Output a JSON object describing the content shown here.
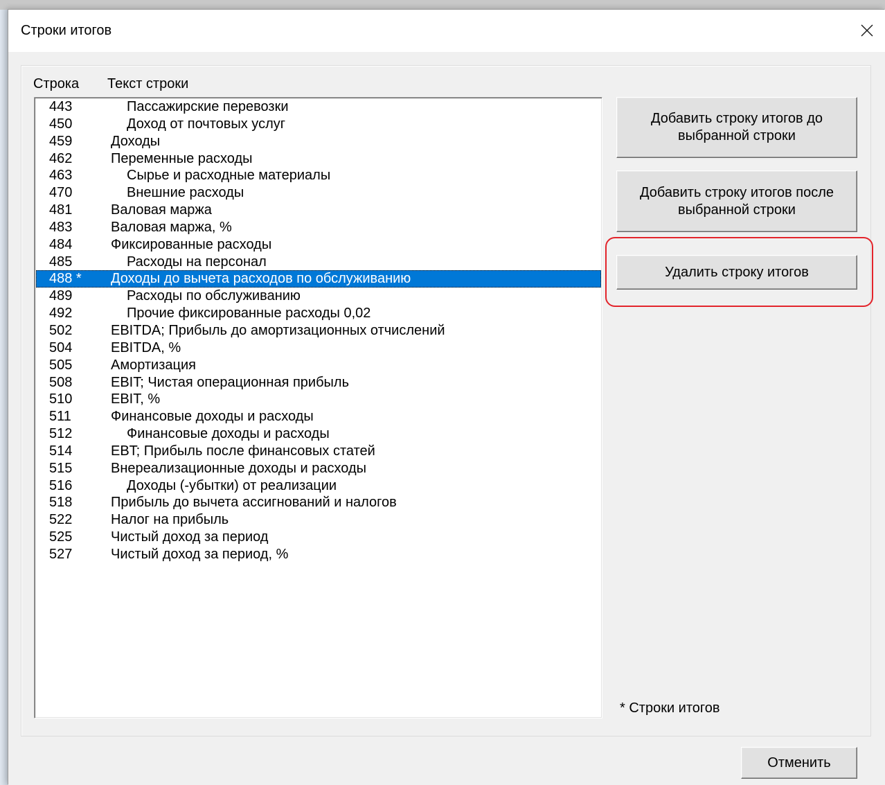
{
  "window": {
    "title": "Строки итогов",
    "close_icon": "close-icon"
  },
  "list": {
    "headers": {
      "number": "Строка",
      "text": "Текст строки"
    },
    "rows": [
      {
        "number": "443",
        "text": "Пассажирские перевозки",
        "level": 1
      },
      {
        "number": "450",
        "text": "Доход от почтовых услуг",
        "level": 1
      },
      {
        "number": "459",
        "text": "Доходы",
        "level": 0
      },
      {
        "number": "462",
        "text": "Переменные расходы",
        "level": 0
      },
      {
        "number": "463",
        "text": "Сырье и расходные материалы",
        "level": 1
      },
      {
        "number": "470",
        "text": "Внешние расходы",
        "level": 1
      },
      {
        "number": "481",
        "text": "Валовая маржа",
        "level": 0
      },
      {
        "number": "483",
        "text": "Валовая маржа, %",
        "level": 0
      },
      {
        "number": "484",
        "text": "Фиксированные расходы",
        "level": 0
      },
      {
        "number": "485",
        "text": "Расходы на персонал",
        "level": 1
      },
      {
        "number": "488 *",
        "text": "Доходы до вычета расходов по обслуживанию",
        "level": 0,
        "selected": true
      },
      {
        "number": "489",
        "text": "Расходы по обслуживанию",
        "level": 1
      },
      {
        "number": "492",
        "text": "Прочие фиксированные расходы 0,02",
        "level": 1
      },
      {
        "number": "502",
        "text": "EBITDA; Прибыль до амортизационных отчислений",
        "level": 0
      },
      {
        "number": "504",
        "text": "EBITDA, %",
        "level": 0
      },
      {
        "number": "505",
        "text": "Амортизация",
        "level": 0
      },
      {
        "number": "508",
        "text": "EBIT; Чистая операционная прибыль",
        "level": 0
      },
      {
        "number": "510",
        "text": "EBIT, %",
        "level": 0
      },
      {
        "number": "511",
        "text": "Финансовые доходы и расходы",
        "level": 0
      },
      {
        "number": "512",
        "text": "Финансовые доходы и расходы",
        "level": 1
      },
      {
        "number": "514",
        "text": "EBT; Прибыль после финансовых статей",
        "level": 0
      },
      {
        "number": "515",
        "text": "Внереализационные доходы и расходы",
        "level": 0
      },
      {
        "number": "516",
        "text": "Доходы (-убытки) от реализации",
        "level": 1
      },
      {
        "number": "518",
        "text": "Прибыль до вычета ассигнований и налогов",
        "level": 0
      },
      {
        "number": "522",
        "text": "Налог на прибыль",
        "level": 0
      },
      {
        "number": "525",
        "text": "Чистый доход за период",
        "level": 0
      },
      {
        "number": "527",
        "text": "Чистый доход за период, %",
        "level": 0
      }
    ]
  },
  "buttons": {
    "add_before": "Добавить строку итогов до выбранной строки",
    "add_after": "Добавить строку итогов после выбранной строки",
    "delete": "Удалить строку итогов",
    "cancel": "Отменить"
  },
  "legend_note": "* Строки итогов",
  "colors": {
    "selection": "#0078d7",
    "highlight_frame": "#e3242b",
    "dialog_background": "#f0f0f0"
  }
}
